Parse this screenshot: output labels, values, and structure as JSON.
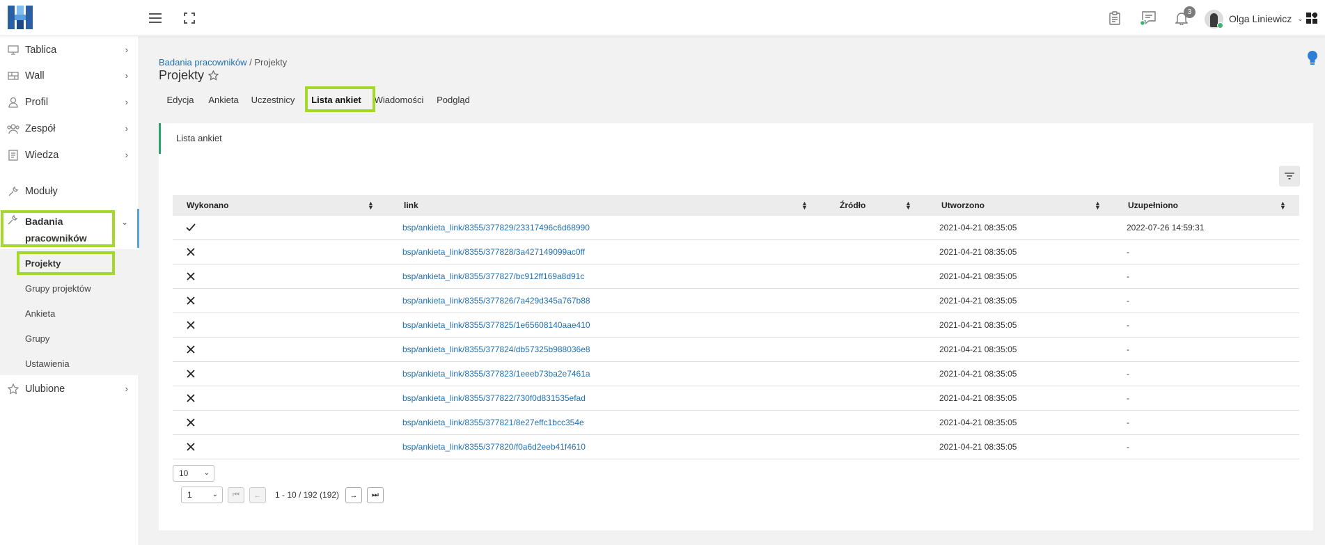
{
  "app": {
    "accent": "#1f6fb2",
    "highlight": "#a4d82b",
    "panel_border": "#27a36b"
  },
  "topbar": {
    "icons": [
      "menu-icon",
      "fullscreen-icon",
      "clipboard-icon",
      "messages-icon",
      "bell-icon",
      "apps-icon"
    ],
    "notifications_count": "3",
    "user_name": "Olga Liniewicz"
  },
  "sidebar": {
    "items": [
      {
        "label": "Tablica",
        "icon": "monitor-icon"
      },
      {
        "label": "Wall",
        "icon": "wall-icon"
      },
      {
        "label": "Profil",
        "icon": "user-icon"
      },
      {
        "label": "Zespół",
        "icon": "team-icon"
      },
      {
        "label": "Wiedza",
        "icon": "book-icon"
      },
      {
        "label": "Moduły",
        "icon": "wrench-icon"
      },
      {
        "label": "Badania pracowników",
        "icon": "wrench-icon"
      },
      {
        "label": "Ulubione",
        "icon": "star-icon"
      }
    ],
    "active_line1": "Badania",
    "active_line2": "pracowników",
    "submenu": [
      "Projekty",
      "Grupy projektów",
      "Ankieta",
      "Grupy",
      "Ustawienia"
    ]
  },
  "breadcrumb": {
    "parent": "Badania pracowników",
    "separator": "/",
    "current": "Projekty"
  },
  "page_title": "Projekty",
  "tabs": [
    "Edycja",
    "Ankieta",
    "Uczestnicy",
    "Lista ankiet",
    "Wiadomości",
    "Podgląd"
  ],
  "panel": {
    "title": "Lista ankiet"
  },
  "table": {
    "columns": [
      "Wykonano",
      "link",
      "Źródło",
      "Utworzono",
      "Uzupełniono"
    ],
    "rows": [
      {
        "done": true,
        "link": "bsp/ankieta_link/8355/377829/23317496c6d68990",
        "source": "",
        "created": "2021-04-21 08:35:05",
        "completed": "2022-07-26 14:59:31"
      },
      {
        "done": false,
        "link": "bsp/ankieta_link/8355/377828/3a427149099ac0ff",
        "source": "",
        "created": "2021-04-21 08:35:05",
        "completed": "-"
      },
      {
        "done": false,
        "link": "bsp/ankieta_link/8355/377827/bc912ff169a8d91c",
        "source": "",
        "created": "2021-04-21 08:35:05",
        "completed": "-"
      },
      {
        "done": false,
        "link": "bsp/ankieta_link/8355/377826/7a429d345a767b88",
        "source": "",
        "created": "2021-04-21 08:35:05",
        "completed": "-"
      },
      {
        "done": false,
        "link": "bsp/ankieta_link/8355/377825/1e65608140aae410",
        "source": "",
        "created": "2021-04-21 08:35:05",
        "completed": "-"
      },
      {
        "done": false,
        "link": "bsp/ankieta_link/8355/377824/db57325b988036e8",
        "source": "",
        "created": "2021-04-21 08:35:05",
        "completed": "-"
      },
      {
        "done": false,
        "link": "bsp/ankieta_link/8355/377823/1eeeb73ba2e7461a",
        "source": "",
        "created": "2021-04-21 08:35:05",
        "completed": "-"
      },
      {
        "done": false,
        "link": "bsp/ankieta_link/8355/377822/730f0d831535efad",
        "source": "",
        "created": "2021-04-21 08:35:05",
        "completed": "-"
      },
      {
        "done": false,
        "link": "bsp/ankieta_link/8355/377821/8e27effc1bcc354e",
        "source": "",
        "created": "2021-04-21 08:35:05",
        "completed": "-"
      },
      {
        "done": false,
        "link": "bsp/ankieta_link/8355/377820/f0a6d2eeb41f4610",
        "source": "",
        "created": "2021-04-21 08:35:05",
        "completed": "-"
      }
    ]
  },
  "pagination": {
    "page_size": "10",
    "page": "1",
    "info": "1 - 10 / 192 (192)"
  }
}
